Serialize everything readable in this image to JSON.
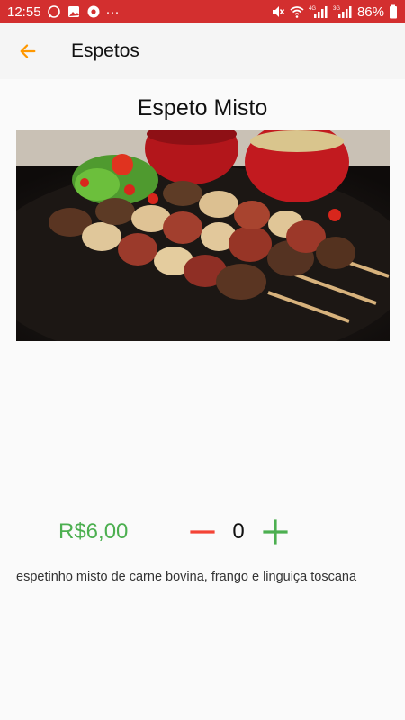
{
  "status_bar": {
    "time": "12:55",
    "battery_percent": "86%",
    "overflow": "···",
    "left_icons": [
      "whatsapp-icon",
      "gallery-icon",
      "chrome-icon"
    ],
    "right_icons": [
      "mute-icon",
      "wifi-icon",
      "signal-4g-icon",
      "signal-3g-icon",
      "battery-icon"
    ],
    "network_labels": [
      "4G",
      "3G"
    ],
    "color": "#d32f2f"
  },
  "app_bar": {
    "title": "Espetos",
    "back_icon": "arrow-back-icon",
    "back_icon_color": "#ff9800"
  },
  "product": {
    "name": "Espeto Misto",
    "image_alt": "Espeto misto photo",
    "price": "R$6,00",
    "price_color": "#4caf50",
    "quantity": "0",
    "minus_icon": "minus-icon",
    "minus_color": "#f44336",
    "plus_icon": "plus-icon",
    "plus_color": "#4caf50",
    "description": "espetinho misto de carne bovina, frango e linguiça toscana"
  }
}
